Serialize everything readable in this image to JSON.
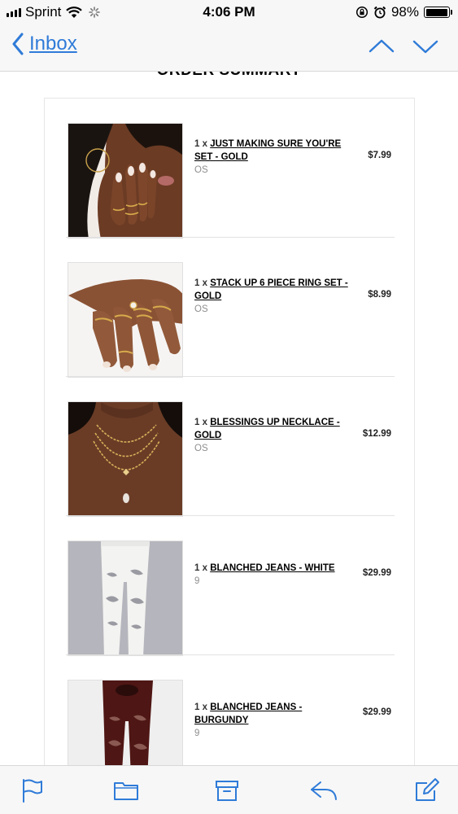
{
  "status": {
    "carrier": "Sprint",
    "time": "4:06 PM",
    "battery": "98%",
    "battery_level": 0.98
  },
  "nav": {
    "back_label": "Inbox"
  },
  "email": {
    "section_title": "ORDER SUMMARY",
    "items": [
      {
        "qty": "1 x",
        "name": "JUST MAKING SURE YOU'RE SET - GOLD",
        "variant": "OS",
        "price": "$7.99",
        "image": "hand-with-rings-at-face"
      },
      {
        "qty": "1 x",
        "name": "STACK UP 6 PIECE RING SET - GOLD",
        "variant": "OS",
        "price": "$8.99",
        "image": "hand-with-gold-rings"
      },
      {
        "qty": "1 x",
        "name": "BLESSINGS UP NECKLACE - GOLD",
        "variant": "OS",
        "price": "$12.99",
        "image": "layered-gold-necklaces"
      },
      {
        "qty": "1 x",
        "name": "BLANCHED JEANS - WHITE",
        "variant": "9",
        "price": "$29.99",
        "image": "white-ripped-jeans"
      },
      {
        "qty": "1 x",
        "name": "BLANCHED JEANS - BURGUNDY",
        "variant": "9",
        "price": "$29.99",
        "image": "burgundy-ripped-jeans"
      }
    ]
  },
  "colors": {
    "accent": "#2f7bd8",
    "bar_background": "#f7f7f7"
  },
  "toolbar": {
    "icons": [
      "flag-icon",
      "folder-icon",
      "archive-icon",
      "reply-icon",
      "compose-icon"
    ]
  }
}
